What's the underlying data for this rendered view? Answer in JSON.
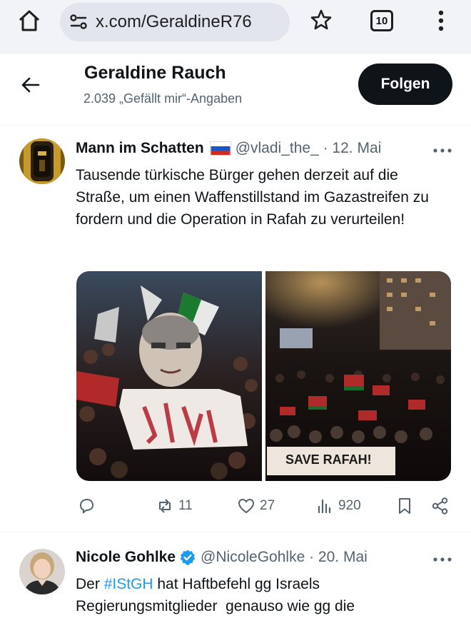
{
  "browser": {
    "url": "x.com/GeraldineR76",
    "tab_count": "10",
    "icons": [
      "home-icon",
      "site-settings-icon",
      "star-icon",
      "tabs-icon",
      "kebab-menu-icon"
    ]
  },
  "profile": {
    "name": "Geraldine Rauch",
    "likes_label": "2.039 „Gefällt mir“-Angaben",
    "follow_label": "Folgen"
  },
  "tweets": [
    {
      "author": "Mann im Schatten",
      "flag": "russia-flag",
      "handle_date": "@vladi_the_ · 12. Mai",
      "text": "Tausende türkische Bürger gehen derzeit auf die Straße, um einen Waffenstillstand im Gazastreifen zu fordern und die Operation in Rafah zu verurteilen!",
      "banner_text": "SAVE RAFAH!",
      "stats": {
        "replies": "",
        "reposts": "11",
        "likes": "27",
        "views": "920"
      }
    },
    {
      "author": "Nicole Gohlke",
      "handle_date": "@NicoleGohlke · 20. Mai",
      "text_before": "Der ",
      "hashtag": "#IStGH",
      "text_after": " hat Haftbefehl gg Israels Regierungsmitglieder  genauso wie gg die"
    }
  ],
  "colors": {
    "accent": "#1d9bf0",
    "text": "#0f1419",
    "muted": "#536471",
    "follow_bg": "#0f1419"
  }
}
